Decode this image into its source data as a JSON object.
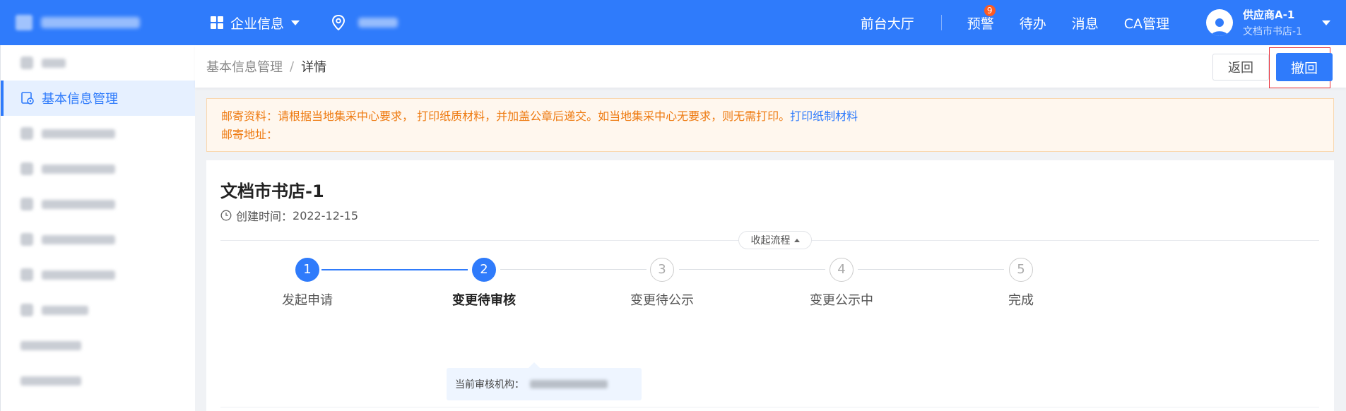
{
  "header": {
    "enterprise_menu": "企业信息",
    "nav": {
      "hall": "前台大厅",
      "warning": "预警",
      "warning_count": "9",
      "todo": "待办",
      "message": "消息",
      "ca": "CA管理"
    },
    "user": {
      "name": "供应商A-1",
      "org": "文档市书店-1"
    }
  },
  "sidebar": {
    "active_label": "基本信息管理"
  },
  "breadcrumb": {
    "parent": "基本信息管理",
    "separator": "/",
    "current": "详情"
  },
  "actions": {
    "back": "返回",
    "withdraw": "撤回"
  },
  "notice": {
    "line1": "邮寄资料：请根据当地集采中心要求， 打印纸质材料，并加盖公章后递交。如当地集采中心无要求，则无需打印。",
    "link": "打印纸制材料",
    "line2": "邮寄地址："
  },
  "detail": {
    "title": "文档市书店-1",
    "created_label": "创建时间：",
    "created_date": "2022-12-15",
    "collapse": "收起流程"
  },
  "steps": [
    {
      "num": "1",
      "label": "发起申请",
      "state": "done"
    },
    {
      "num": "2",
      "label": "变更待审核",
      "state": "current"
    },
    {
      "num": "3",
      "label": "变更待公示",
      "state": "todo"
    },
    {
      "num": "4",
      "label": "变更公示中",
      "state": "todo"
    },
    {
      "num": "5",
      "label": "完成",
      "state": "todo"
    }
  ],
  "review": {
    "label": "当前审核机构："
  },
  "colors": {
    "primary": "#2f7bfb",
    "warning_text": "#ee7a10",
    "highlight_border": "#e8303a"
  }
}
